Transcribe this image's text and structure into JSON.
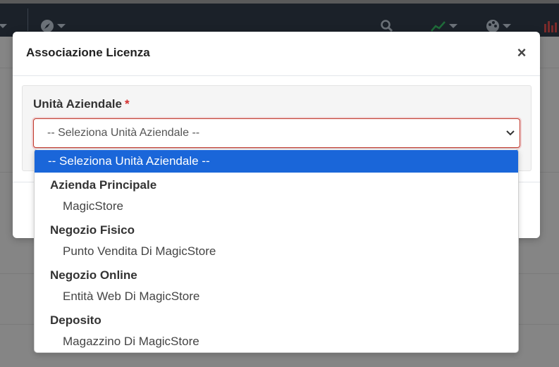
{
  "modal": {
    "title": "Associazione Licenza",
    "close_label": "×"
  },
  "field": {
    "label": "Unità Aziendale",
    "required_mark": "*",
    "selected_value": "-- Seleziona Unità Aziendale --"
  },
  "dropdown": {
    "selected_option": "-- Seleziona Unità Aziendale --",
    "groups": [
      {
        "label": "Azienda Principale",
        "items": [
          "MagicStore"
        ]
      },
      {
        "label": "Negozio Fisico",
        "items": [
          "Punto Vendita Di MagicStore"
        ]
      },
      {
        "label": "Negozio Online",
        "items": [
          "Entità Web Di MagicStore"
        ]
      },
      {
        "label": "Deposito",
        "items": [
          "Magazzino Di MagicStore"
        ]
      }
    ]
  },
  "colors": {
    "accent": "#1a66d9",
    "error_border": "#c0392b",
    "required": "#d32f2f"
  }
}
